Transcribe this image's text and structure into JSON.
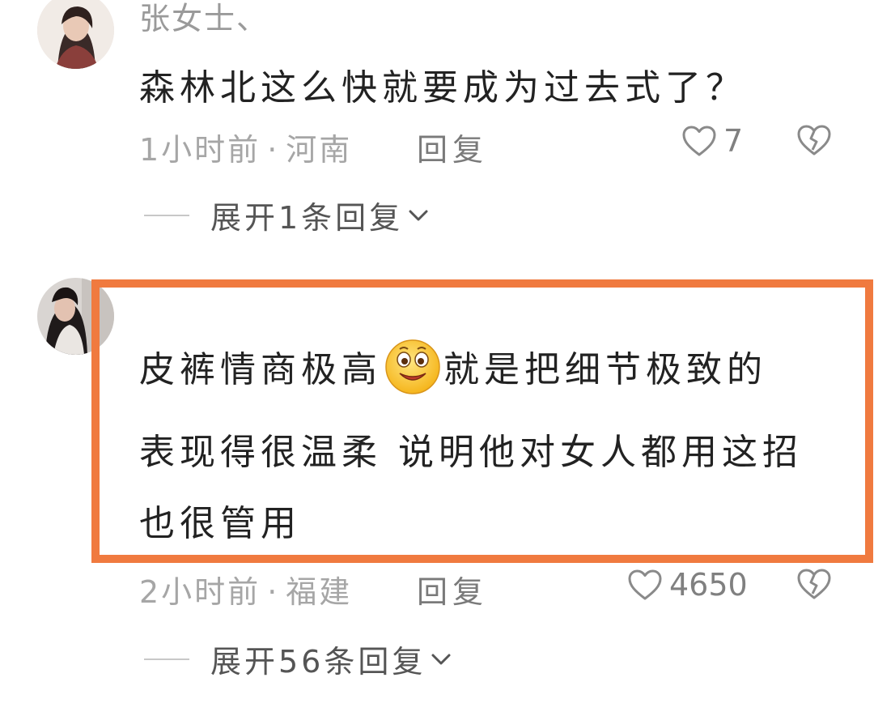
{
  "comments": [
    {
      "username": "张女士、",
      "text": "森林北这么快就要成为过去式了？",
      "time": "1小时前",
      "location": "河南",
      "reply_label": "回复",
      "likes": "7",
      "expand_label": "展开1条回复"
    },
    {
      "text_line1_a": "皮裤情商极高",
      "text_line1_b": "就是把细节极致的",
      "text_line2": "表现得很温柔 说明他对女人都用这招",
      "text_line3": "也很管用",
      "time": "2小时前",
      "location": "福建",
      "reply_label": "回复",
      "likes": "4650",
      "expand_label": "展开56条回复"
    }
  ],
  "separator": "·",
  "colors": {
    "highlight": "#f07a3f",
    "meta_text": "#a6a6a6",
    "body_text": "#222222"
  },
  "icons": {
    "like": "heart-outline-icon",
    "dislike": "broken-heart-icon",
    "expand": "chevron-down-icon",
    "emoji": "smiling-face-emoji"
  }
}
